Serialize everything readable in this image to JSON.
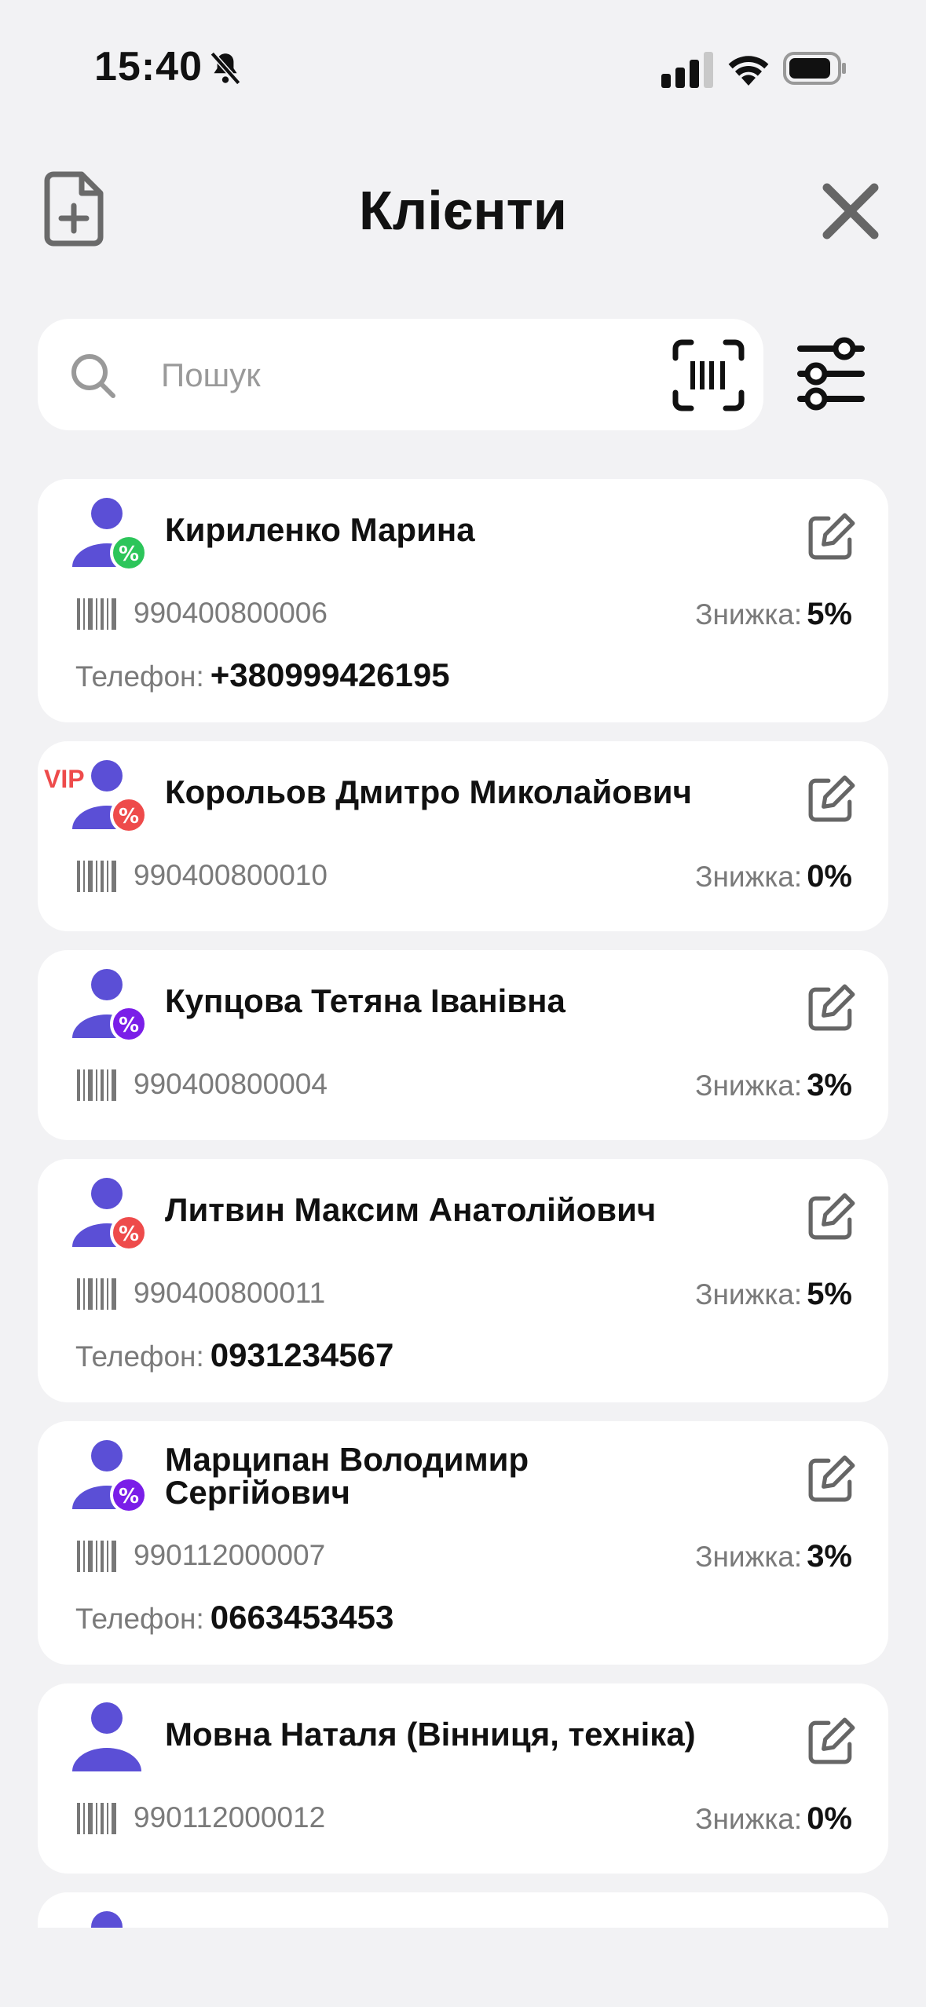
{
  "status_bar": {
    "time": "15:40"
  },
  "header": {
    "title": "Клієнти"
  },
  "search": {
    "placeholder": "Пошук",
    "value": ""
  },
  "labels": {
    "discount": "Знижка:",
    "phone": "Телефон:"
  },
  "colors": {
    "accent": "#5b4fd6",
    "badge_green": "#2cc55a",
    "badge_red": "#ee4b4b",
    "badge_purple": "#7a1ee8"
  },
  "clients": [
    {
      "name": "Кириленко Марина",
      "code": "990400800006",
      "discount": "5%",
      "phone": "+380999426195",
      "badge": "green",
      "vip": ""
    },
    {
      "name": "Корольов Дмитро Миколайович",
      "code": "990400800010",
      "discount": "0%",
      "phone": "",
      "badge": "red",
      "vip": "VIP"
    },
    {
      "name": "Купцова Тетяна Іванівна",
      "code": "990400800004",
      "discount": "3%",
      "phone": "",
      "badge": "purple",
      "vip": ""
    },
    {
      "name": "Литвин Максим Анатолійович",
      "code": "990400800011",
      "discount": "5%",
      "phone": "0931234567",
      "badge": "red",
      "vip": ""
    },
    {
      "name": "Марципан Володимир Сергійович",
      "code": "990112000007",
      "discount": "3%",
      "phone": "0663453453",
      "badge": "purple",
      "vip": ""
    },
    {
      "name": "Мовна Наталя (Вінниця, техніка)",
      "code": "990112000012",
      "discount": "0%",
      "phone": "",
      "badge": "",
      "vip": ""
    }
  ]
}
